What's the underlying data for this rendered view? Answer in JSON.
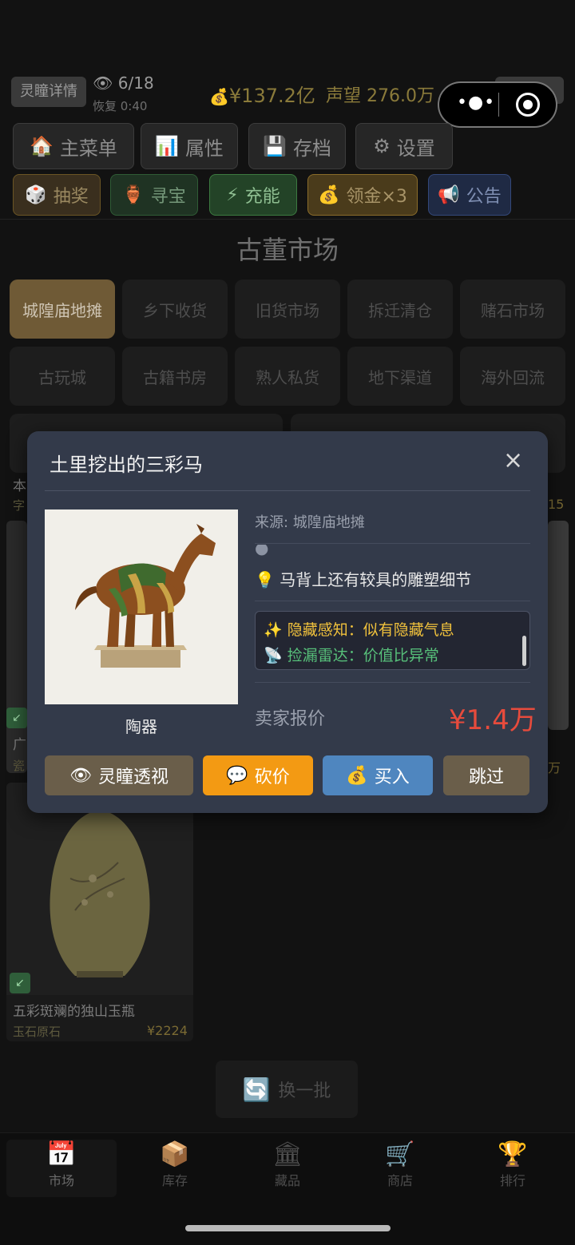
{
  "header": {
    "eye_detail_label": "灵瞳详情",
    "eye_count": "6/18",
    "recover": "恢复 0:40",
    "money": "¥137.2亿",
    "fame": "声望 276.0万"
  },
  "menu": {
    "row1": [
      {
        "label": "主菜单",
        "icon": "house-icon",
        "glyph": "🏠"
      },
      {
        "label": "属性",
        "icon": "chart-icon",
        "glyph": "📊"
      },
      {
        "label": "存档",
        "icon": "save-icon",
        "glyph": "💾"
      },
      {
        "label": "设置",
        "icon": "gear-icon",
        "glyph": "⚙"
      }
    ],
    "row2": [
      {
        "label": "抽奖",
        "icon": "dice-icon",
        "glyph": "🎲"
      },
      {
        "label": "寻宝",
        "icon": "vase-icon",
        "glyph": "🏺"
      },
      {
        "label": "充能",
        "icon": "lightning-icon",
        "glyph": "⚡"
      },
      {
        "label": "领金×3",
        "icon": "money-bag-icon",
        "glyph": "💰"
      },
      {
        "label": "公告",
        "icon": "megaphone-icon",
        "glyph": "📢"
      }
    ]
  },
  "market": {
    "title": "古董市场",
    "locations_row1": [
      "城隍庙地摊",
      "乡下收货",
      "旧货市场",
      "拆迁清仓",
      "赌石市场"
    ],
    "locations_row2": [
      "古玩城",
      "古籍书房",
      "熟人私货",
      "地下渠道",
      "海外回流"
    ],
    "active_location": "城隍庙地摊"
  },
  "cards": {
    "peek_left_a": "本",
    "peek_left_b": "字",
    "peek_right_price": "15",
    "left_mid_title": "广",
    "left_mid_cat": "瓷",
    "right_mid_price": "万",
    "vase": {
      "title": "五彩斑斓的独山玉瓶",
      "category": "玉石原石",
      "price": "¥2224"
    }
  },
  "refresh_label": "换一批",
  "bottom_nav": [
    {
      "label": "市场",
      "icon": "calendar-icon",
      "glyph": "📅"
    },
    {
      "label": "库存",
      "icon": "box-icon",
      "glyph": "📦"
    },
    {
      "label": "藏品",
      "icon": "museum-icon",
      "glyph": "🏛"
    },
    {
      "label": "商店",
      "icon": "cart-icon",
      "glyph": "🛒"
    },
    {
      "label": "排行",
      "icon": "trophy-icon",
      "glyph": "🏆"
    }
  ],
  "modal": {
    "title": "土里挖出的三彩马",
    "close": "×",
    "item_category": "陶器",
    "source": "来源: 城隍庙地摊",
    "hint": "马背上还有较具的雕塑细节",
    "perk1": "隐藏感知：似有隐藏气息",
    "perk2": "捡漏雷达：价值比异常",
    "price_label": "卖家报价",
    "price": "¥1.4万",
    "buttons": {
      "eye": "灵瞳透视",
      "bargain": "砍价",
      "buy": "买入",
      "skip": "跳过"
    }
  }
}
